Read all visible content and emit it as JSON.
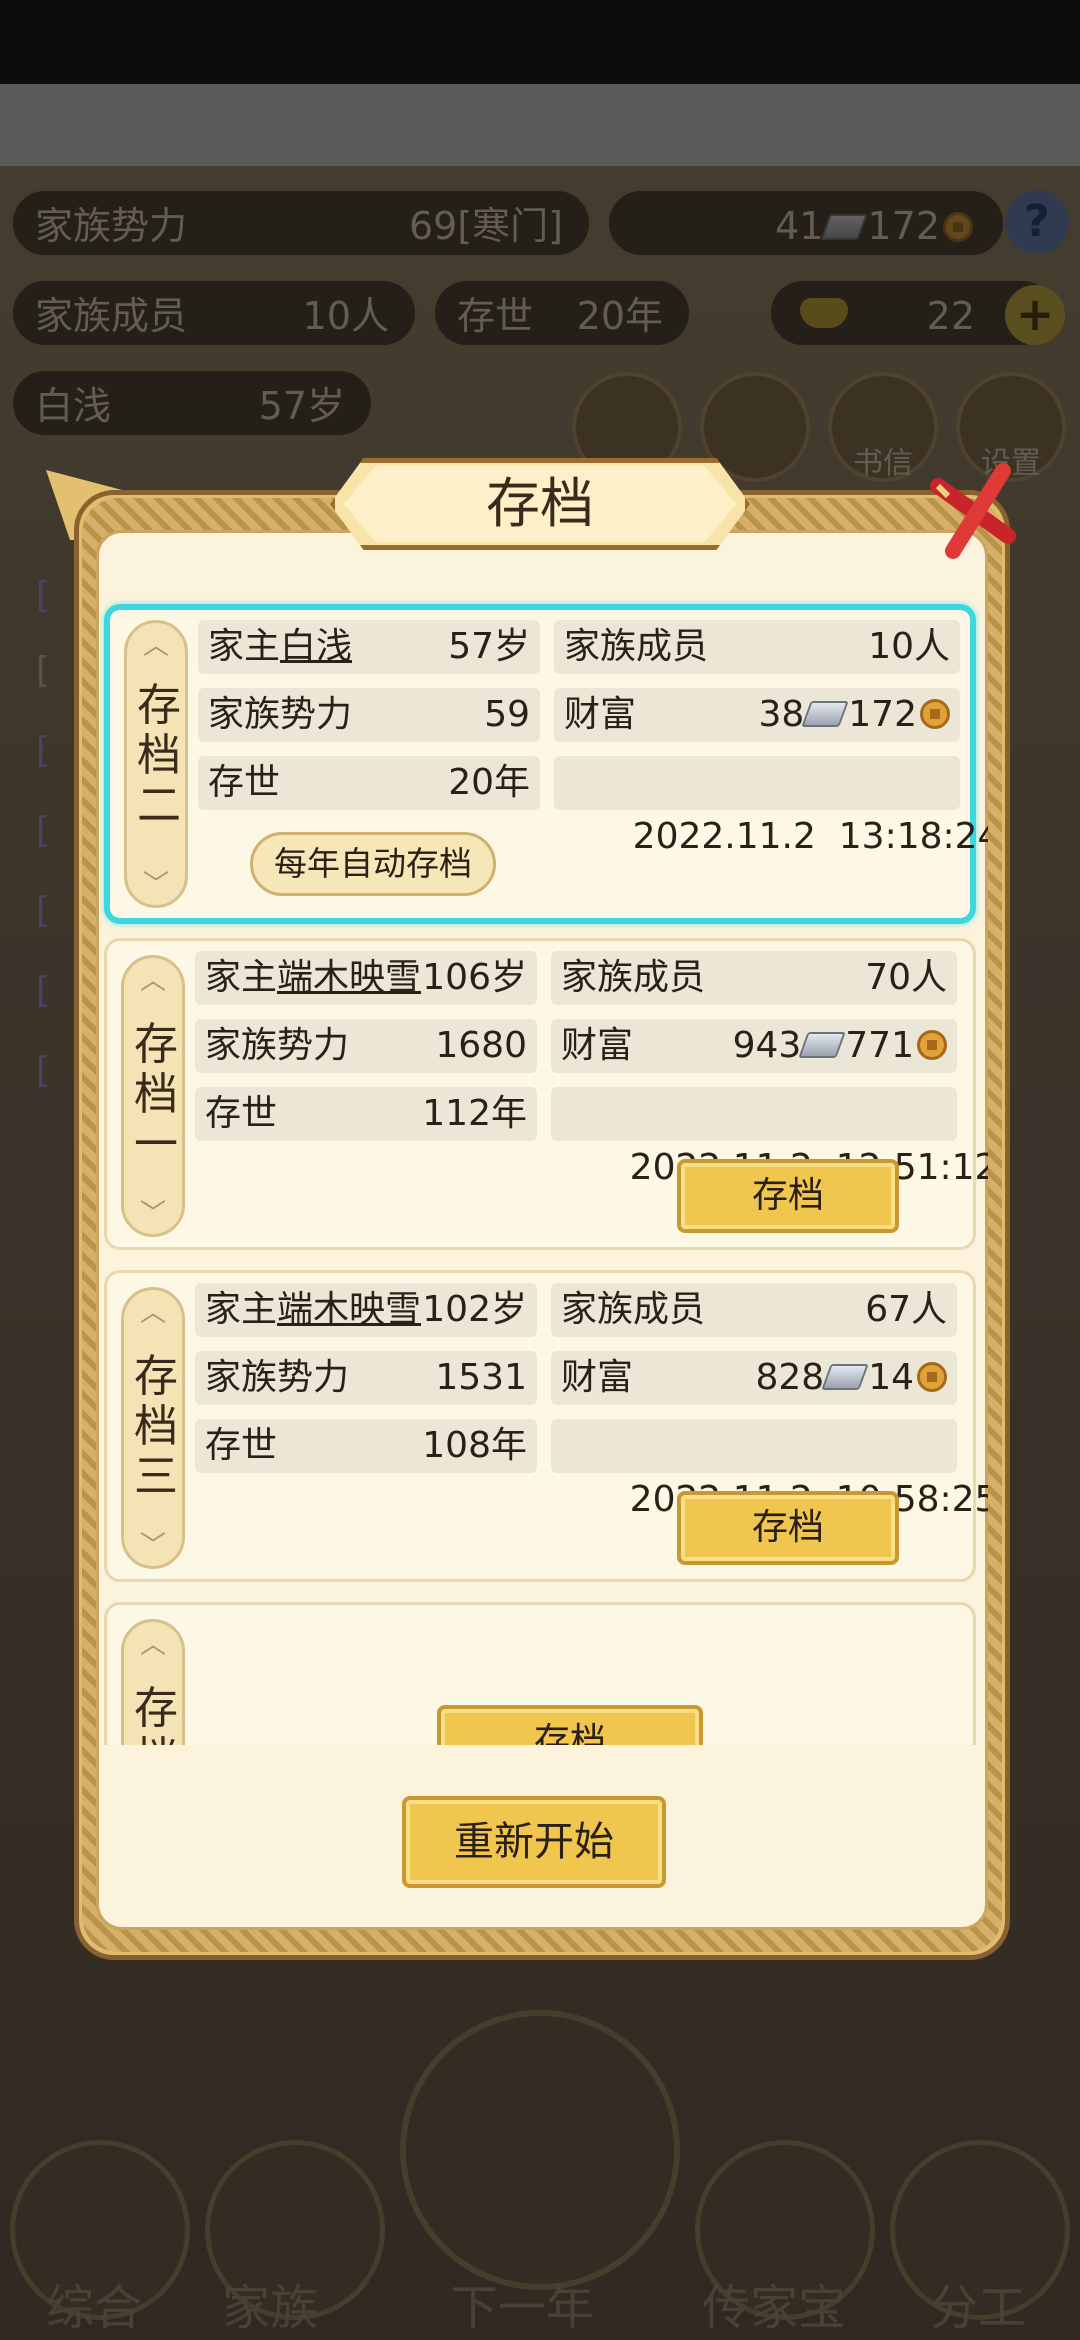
{
  "background": {
    "stats": {
      "clan_power_label": "家族势力",
      "clan_power_value": "69[寒门]",
      "wealth_silver": "41",
      "wealth_copper": "172",
      "members_label": "家族成员",
      "members_value": "10人",
      "era_label": "存世",
      "era_value": "20年",
      "gold_value": "22",
      "head_name": "白浅",
      "head_age": "57岁"
    },
    "menu_labels": [
      "书信",
      "设置"
    ],
    "bottom_nav": [
      "综合",
      "家族",
      "下一年",
      "传家宝",
      "分工"
    ]
  },
  "dialog": {
    "title": "存档",
    "slots": [
      {
        "label": "存档二",
        "head_prefix": "家主",
        "head_name": "白浅",
        "head_age": "57岁",
        "members_label": "家族成员",
        "members_value": "10人",
        "power_label": "家族势力",
        "power_value": "59",
        "wealth_label": "财富",
        "silver": "38",
        "copper": "172",
        "era_label": "存世",
        "era_value": "20年",
        "timestamp": "2022.11.2  13:18:24",
        "button": "每年自动存档"
      },
      {
        "label": "存档一",
        "head_prefix": "家主",
        "head_name": "端木映雪",
        "head_age": "106岁",
        "members_label": "家族成员",
        "members_value": "70人",
        "power_label": "家族势力",
        "power_value": "1680",
        "wealth_label": "财富",
        "silver": "943",
        "copper": "771",
        "era_label": "存世",
        "era_value": "112年",
        "timestamp": "2022.11.2  12:51:12",
        "button": "存档"
      },
      {
        "label": "存档三",
        "head_prefix": "家主",
        "head_name": "端木映雪",
        "head_age": "102岁",
        "members_label": "家族成员",
        "members_value": "67人",
        "power_label": "家族势力",
        "power_value": "1531",
        "wealth_label": "财富",
        "silver": "828",
        "copper": "14",
        "era_label": "存世",
        "era_value": "108年",
        "timestamp": "2022.11.2  10:58:25",
        "button": "存档"
      },
      {
        "label": "存档四",
        "button": "存档"
      }
    ],
    "restart_button": "重新开始"
  },
  "colors": {
    "selected_border": "#3fd6e0",
    "button_gold": "#f0c64e",
    "panel_bg": "#fbf3dc"
  }
}
